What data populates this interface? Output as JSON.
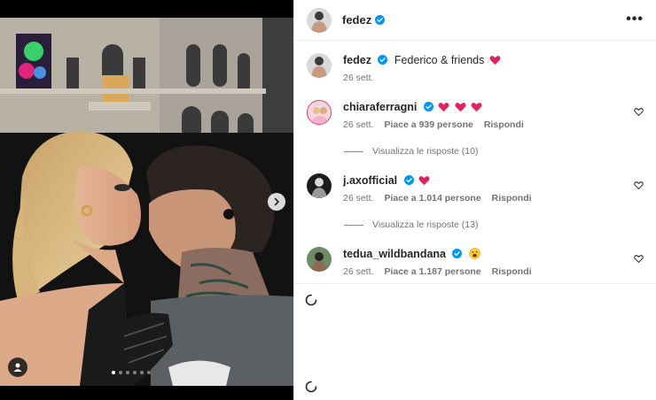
{
  "post": {
    "author": "fedez",
    "caption": "Federico & friends",
    "date": "26 sett.",
    "carousel": {
      "count": 6,
      "active_index": 0
    }
  },
  "icons": {
    "more": "more-horizontal-icon",
    "verified": "verified-badge-icon",
    "next": "chevron-right-icon",
    "tag": "user-tag-icon",
    "like": "heart-outline-icon"
  },
  "colors": {
    "verified": "#0095f6",
    "heart_emoji": "#e0245e",
    "secondary_text": "#737373"
  },
  "comments": [
    {
      "username": "chiaraferragni",
      "date": "26 sett.",
      "likes": "Piace a 939 persone",
      "reply_label": "Rispondi",
      "view_replies": "Visualizza le risposte (10)"
    },
    {
      "username": "j.axofficial",
      "date": "26 sett.",
      "likes": "Piace a 1.014 persone",
      "reply_label": "Rispondi",
      "view_replies": "Visualizza le risposte (13)"
    },
    {
      "username": "tedua_wildbandana",
      "date": "26 sett.",
      "likes": "Piace a 1.187 persone",
      "reply_label": "Rispondi"
    }
  ]
}
